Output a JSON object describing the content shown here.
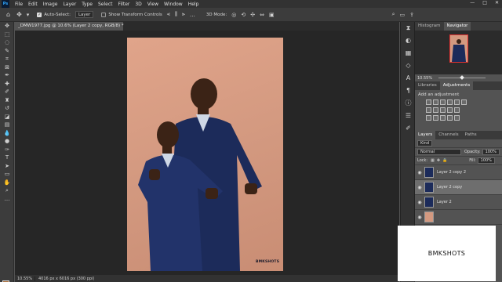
{
  "menubar": {
    "logo": "Ps",
    "items": [
      "File",
      "Edit",
      "Image",
      "Layer",
      "Type",
      "Select",
      "Filter",
      "3D",
      "View",
      "Window",
      "Help"
    ],
    "window_controls": [
      "—",
      "□",
      "✕"
    ]
  },
  "options_bar": {
    "auto_select_label": "Auto-Select:",
    "auto_select_value": "Layer",
    "show_transform_label": "Show Transform Controls",
    "mode_3d_label": "3D Mode:"
  },
  "document": {
    "tab_title": "_DMW1977.jpg @ 10.6% (Layer 2 copy, RGB/8) *",
    "watermark": "BMKSHOTS"
  },
  "status_bar": {
    "zoom": "10.55%",
    "doc_info": "4016 px x 6016 px (300 ppi)"
  },
  "navigator": {
    "tabs": [
      "Histogram",
      "Navigator"
    ],
    "active_tab": "Navigator",
    "zoom": "10.55%"
  },
  "adjustments": {
    "tabs": [
      "Libraries",
      "Adjustments"
    ],
    "active_tab": "Adjustments",
    "title": "Add an adjustment"
  },
  "layers_panel": {
    "tabs": [
      "Layers",
      "Channels",
      "Paths"
    ],
    "active_tab": "Layers",
    "filter": "Kind",
    "blend_mode": "Normal",
    "opacity_label": "Opacity:",
    "opacity": "100%",
    "lock_label": "Lock:",
    "fill_label": "Fill:",
    "fill": "100%",
    "layers": [
      {
        "name": "Layer 2 copy 2",
        "selected": false
      },
      {
        "name": "Layer 2 copy",
        "selected": true
      },
      {
        "name": "Layer 2",
        "selected": false
      }
    ]
  },
  "brand_overlay": "BMKSHOTS",
  "colors": {
    "foreground": "#a86b3a",
    "background": "#ffffff",
    "backdrop": "#d39980",
    "suit": "#1c2b5a"
  }
}
